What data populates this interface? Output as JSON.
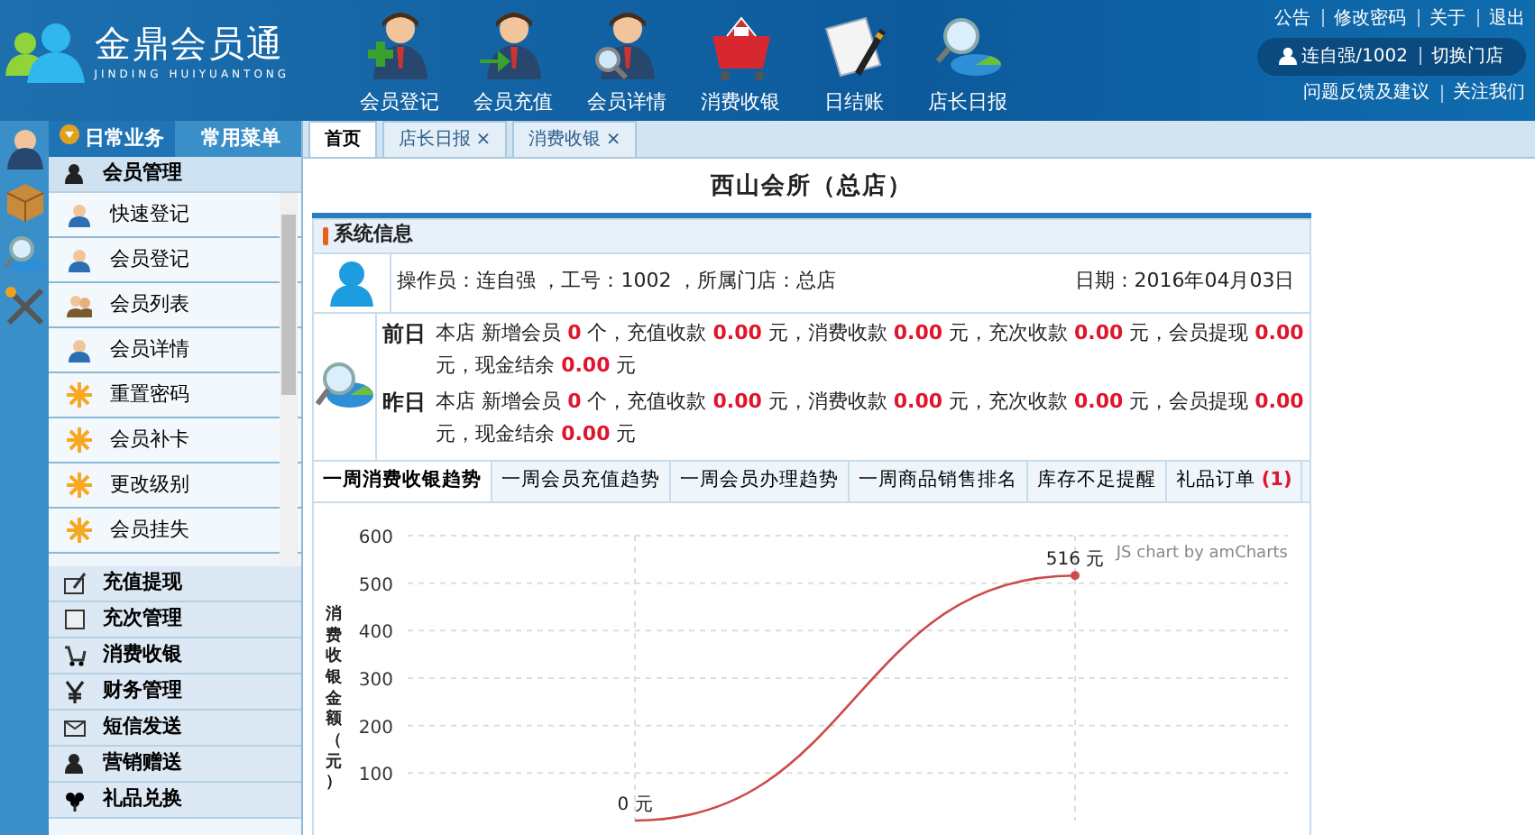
{
  "app": {
    "name": "金鼎会员通",
    "subtitle": "JINDING HUIYUANTONG"
  },
  "toolbar": [
    {
      "label": "会员登记",
      "kind": "add"
    },
    {
      "label": "会员充值",
      "kind": "recharge"
    },
    {
      "label": "会员详情",
      "kind": "detail"
    },
    {
      "label": "消费收银",
      "kind": "cart"
    },
    {
      "label": "日结账",
      "kind": "note"
    },
    {
      "label": "店长日报",
      "kind": "report"
    }
  ],
  "top_links": [
    "公告",
    "修改密码",
    "关于",
    "退出"
  ],
  "user": {
    "name": "连自强/1002",
    "switch_label": "切换门店"
  },
  "bottom_links": [
    "问题反馈及建议",
    "关注我们"
  ],
  "side_strip": [
    {
      "kind": "person"
    },
    {
      "kind": "box"
    },
    {
      "kind": "search"
    },
    {
      "kind": "tools"
    }
  ],
  "menu_tabs": [
    {
      "label": "日常业务",
      "selected": true
    },
    {
      "label": "常用菜单",
      "selected": false
    }
  ],
  "menu_groups": [
    {
      "label": "会员管理",
      "kind": "person",
      "expanded": true,
      "children": [
        {
          "label": "快速登记",
          "kind": "user"
        },
        {
          "label": "会员登记",
          "kind": "user"
        },
        {
          "label": "会员列表",
          "kind": "users"
        },
        {
          "label": "会员详情",
          "kind": "user"
        },
        {
          "label": "重置密码",
          "kind": "gear"
        },
        {
          "label": "会员补卡",
          "kind": "gear"
        },
        {
          "label": "更改级别",
          "kind": "gear"
        },
        {
          "label": "会员挂失",
          "kind": "gear"
        }
      ]
    },
    {
      "label": "充值提现",
      "kind": "edit",
      "expanded": false
    },
    {
      "label": "充次管理",
      "kind": "square",
      "expanded": false
    },
    {
      "label": "消费收银",
      "kind": "cart",
      "expanded": false
    },
    {
      "label": "财务管理",
      "kind": "yen",
      "expanded": false
    },
    {
      "label": "短信发送",
      "kind": "mail",
      "expanded": false
    },
    {
      "label": "营销赠送",
      "kind": "person",
      "expanded": false
    },
    {
      "label": "礼品兑换",
      "kind": "flower",
      "expanded": false
    }
  ],
  "tabs": [
    {
      "label": "首页",
      "selected": true,
      "closable": false
    },
    {
      "label": "店长日报",
      "selected": false,
      "closable": true,
      "close": "×"
    },
    {
      "label": "消费收银",
      "selected": false,
      "closable": true,
      "close": "×"
    }
  ],
  "page_title": "西山会所（总店）",
  "system_info": {
    "title": "系统信息",
    "operator": "操作员：连自强 ，工号：1002 ，所属门店：总店",
    "date": "日期：2016年04月03日",
    "days": [
      {
        "label": "前日",
        "text": "本店 新增会员 **0** 个，充值收款 **0.00** 元，消费收款 **0.00** 元，充次收款 **0.00** 元，会员提现 **0.00** 元，现金结余 **0.00** 元"
      },
      {
        "label": "昨日",
        "text": "本店 新增会员 **0** 个，充值收款 **0.00** 元，消费收款 **0.00** 元，充次收款 **0.00** 元，会员提现 **0.00** 元，现金结余 **0.00** 元"
      }
    ]
  },
  "report_tabs": [
    {
      "label": "一周消费收银趋势",
      "selected": true
    },
    {
      "label": "一周会员充值趋势",
      "selected": false
    },
    {
      "label": "一周会员办理趋势",
      "selected": false
    },
    {
      "label": "一周商品销售排名",
      "selected": false
    },
    {
      "label": "库存不足提醒",
      "selected": false
    },
    {
      "label": "礼品订单 **(1)**",
      "selected": false
    }
  ],
  "chart": {
    "credit": "JS chart by amCharts",
    "chart_data": {
      "type": "line",
      "grid": true,
      "ylabel": "消费收银金额（元）",
      "ylim": [
        0,
        600
      ],
      "yticks": [
        100,
        200,
        300,
        400,
        500,
        600
      ],
      "series": [
        {
          "color": "#cc4b4b",
          "values": [
            0,
            516
          ]
        }
      ],
      "value_labels": [
        "0 元",
        "516 元"
      ]
    }
  }
}
